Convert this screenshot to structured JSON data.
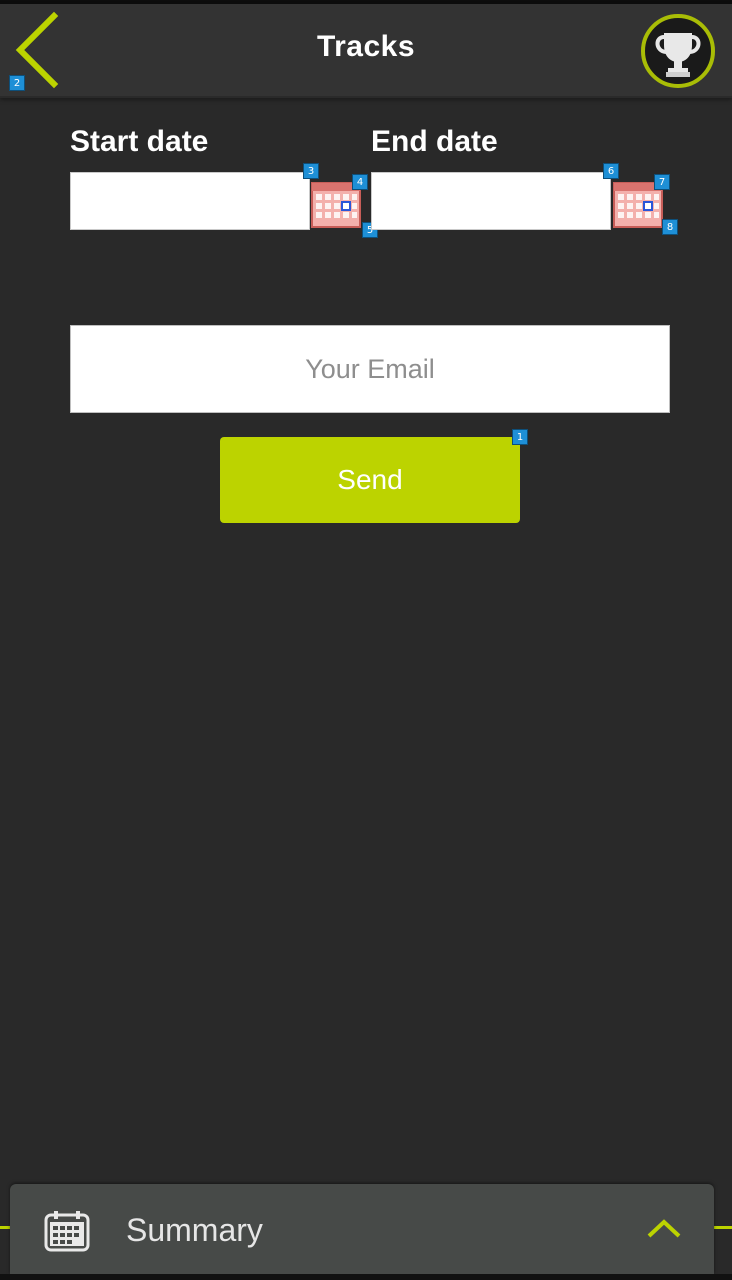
{
  "header": {
    "title": "Tracks",
    "back_icon": "chevron-left-icon",
    "trophy_icon": "trophy-icon"
  },
  "form": {
    "start_date_label": "Start date",
    "end_date_label": "End date",
    "start_date_value": "",
    "end_date_value": "",
    "calendar_icon": "calendar-icon",
    "email_placeholder": "Your Email",
    "email_value": "",
    "send_label": "Send"
  },
  "badges": [
    "1",
    "2",
    "3",
    "4",
    "5",
    "6",
    "7",
    "8"
  ],
  "summary_bar": {
    "label": "Summary",
    "icon": "calendar-icon",
    "chevron": "chevron-up-icon"
  },
  "colors": {
    "accent": "#bcd300",
    "background": "#292929",
    "header": "#333333",
    "summary_bar": "#474a48",
    "badge": "#1e8fd6"
  }
}
